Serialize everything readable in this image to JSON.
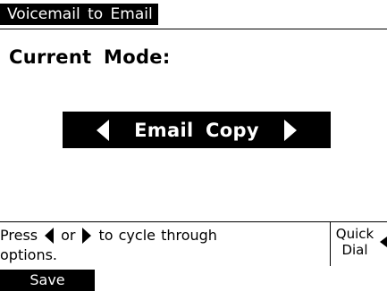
{
  "header": {
    "title": "Voicemail to Email"
  },
  "main": {
    "mode_label": "Current Mode:",
    "mode_value": "Email Copy",
    "icons": {
      "prev": "left-triangle-icon",
      "next": "right-triangle-icon"
    }
  },
  "hint": {
    "line1_before": "Press",
    "line1_middle": "or",
    "line1_after": "to cycle through",
    "line2": "options."
  },
  "side_panel": {
    "quick_dial_label": "Quick Dial"
  },
  "softkeys": {
    "save_label": "Save"
  },
  "colors": {
    "background": "#ffffff",
    "foreground": "#000000",
    "inverse_text": "#ffffff"
  }
}
